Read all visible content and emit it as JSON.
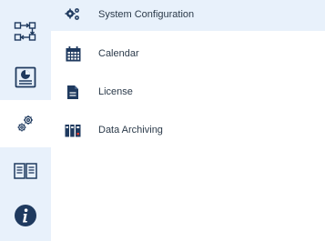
{
  "rail": {
    "items": [
      {
        "icon": "workflow-icon",
        "active": false
      },
      {
        "icon": "report-icon",
        "active": false
      },
      {
        "icon": "gears-icon",
        "active": true
      },
      {
        "icon": "book-icon",
        "active": false
      },
      {
        "icon": "info-icon",
        "active": false
      }
    ]
  },
  "menu": {
    "items": [
      {
        "label": "System Configuration",
        "icon": "gears-icon",
        "active": true
      },
      {
        "label": "Calendar",
        "icon": "calendar-icon",
        "active": false
      },
      {
        "label": "License",
        "icon": "license-icon",
        "active": false
      },
      {
        "label": "Data Archiving",
        "icon": "archive-icon",
        "active": false
      }
    ]
  },
  "colors": {
    "rail_bg": "#e8f1fb",
    "icon_dark": "#1f3a5f",
    "accent_red": "#e03c31"
  }
}
